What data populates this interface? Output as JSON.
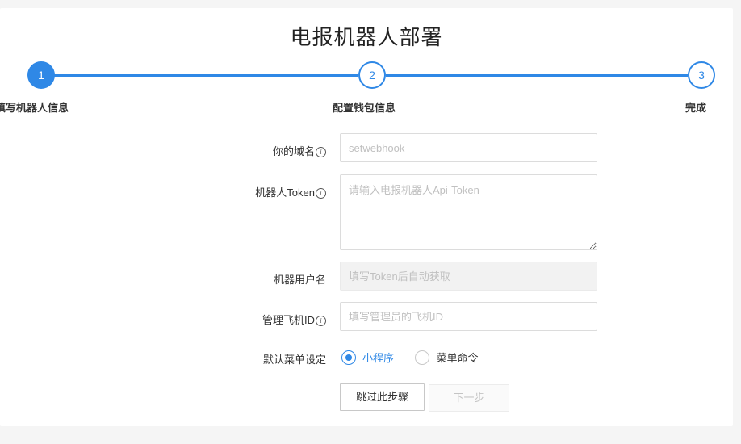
{
  "page": {
    "title": "电报机器人部署"
  },
  "stepper": {
    "steps": [
      {
        "number": "1",
        "label": "填写机器人信息"
      },
      {
        "number": "2",
        "label": "配置钱包信息"
      },
      {
        "number": "3",
        "label": "完成"
      }
    ],
    "active_step": 1,
    "accent_color": "#2f88e6"
  },
  "form": {
    "domain": {
      "label": "你的域名",
      "info_icon": "info-icon",
      "placeholder": "setwebhook",
      "value": ""
    },
    "token": {
      "label": "机器人Token",
      "info_icon": "info-icon",
      "placeholder": "请输入电报机器人Api-Token",
      "value": ""
    },
    "username": {
      "label": "机器用户名",
      "placeholder": "填写Token后自动获取",
      "value": "",
      "disabled": true
    },
    "admin_id": {
      "label": "管理飞机ID",
      "info_icon": "info-icon",
      "placeholder": "填写管理员的飞机ID",
      "value": ""
    },
    "menu": {
      "label": "默认菜单设定",
      "options": [
        "小程序",
        "菜单命令"
      ],
      "selected": "小程序"
    }
  },
  "buttons": {
    "skip": "跳过此步骤",
    "next": "下一步"
  }
}
